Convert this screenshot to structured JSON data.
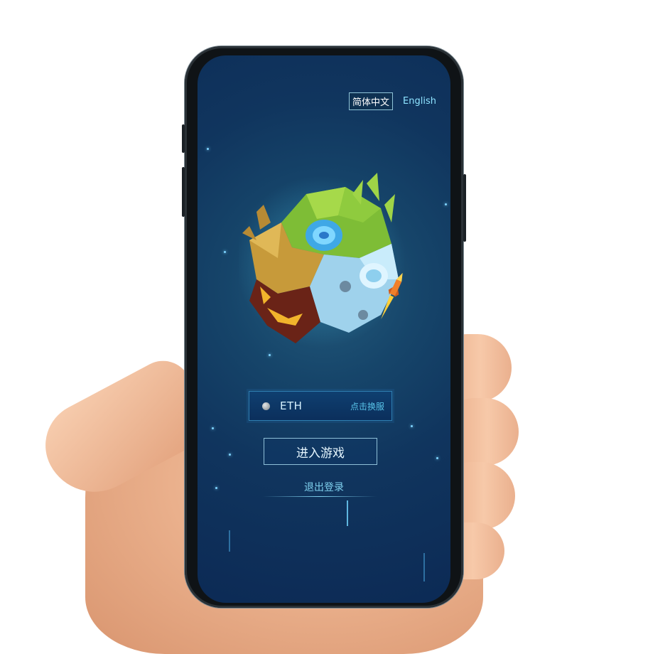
{
  "language": {
    "options": [
      "简体中文",
      "English"
    ],
    "selected": "简体中文"
  },
  "server": {
    "name": "ETH",
    "switch_label": "点击换服"
  },
  "actions": {
    "enter_game": "进入游戏",
    "logout": "退出登录"
  },
  "colors": {
    "screen_bg": "#10355e",
    "accent": "#58c3e8"
  }
}
